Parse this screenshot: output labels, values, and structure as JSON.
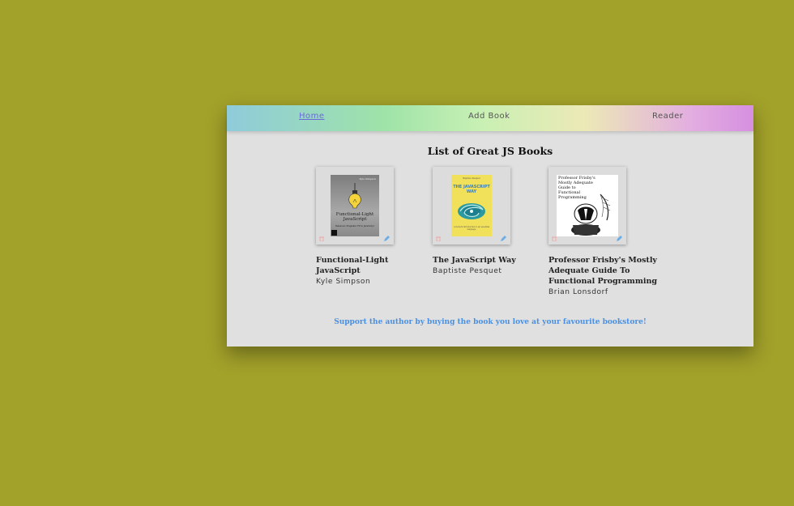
{
  "nav": {
    "items": [
      {
        "label": "Home",
        "active": true
      },
      {
        "label": "Add Book",
        "active": false
      },
      {
        "label": "Reader",
        "active": false
      }
    ]
  },
  "page_title": "List of Great JS Books",
  "books": [
    {
      "title": "Functional-Light JavaScript",
      "author": "Kyle Simpson",
      "cover": {
        "author": "Kyle Simpson",
        "title": "Functional-Light JavaScript",
        "subtitle": "Balanced, Pragmatic FP in JavaScript",
        "bg": "#8c8c8c"
      }
    },
    {
      "title": "The JavaScript Way",
      "author": "Baptiste Pesquet",
      "cover": {
        "author": "Baptiste Pesquet",
        "title": "THE JAVASCRIPT WAY",
        "subtitle": "A modern introduction to an essential language",
        "bg": "#f1e05a"
      }
    },
    {
      "title": "Professor Frisby's Mostly Adequate Guide To Functional Programming",
      "author": "Brian Lonsdorf",
      "cover": {
        "title": "Professor Frisby's Mostly Adequate Guide to Functional Programming",
        "bg": "#ffffff"
      }
    }
  ],
  "footer_note": "Support the author by buying the book you love at your favourite bookstore!",
  "colors": {
    "background": "#a2a12a",
    "panel": "#e0e0e0",
    "active_link": "#6a6ad8",
    "footer_link": "#4a90e2",
    "delete": "#f4a0a0",
    "edit": "#6aaee8"
  },
  "icons": {
    "delete": "trash-icon",
    "edit": "pencil-icon"
  }
}
